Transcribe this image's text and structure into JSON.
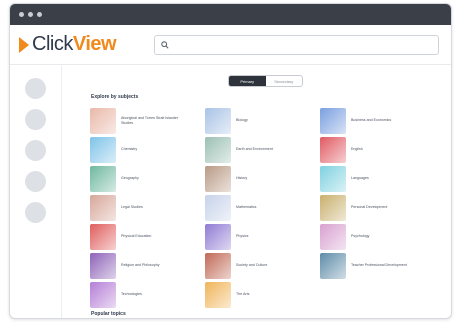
{
  "app": {
    "logo_prefix": "Click",
    "logo_suffix": "View",
    "search_placeholder": ""
  },
  "view_toggle": {
    "options": [
      "Primary",
      "Secondary"
    ],
    "selected": "Primary"
  },
  "sections": {
    "subjects_title": "Explore by subjects",
    "second_title": "Popular topics"
  },
  "subjects": [
    {
      "label": "Aboriginal and Torres Strait Islander Studies",
      "color": "#e9b8a8"
    },
    {
      "label": "Biology",
      "color": "#a9c3e6"
    },
    {
      "label": "Business and Economics",
      "color": "#7a9fe0"
    },
    {
      "label": "Chemistry",
      "color": "#7fc3e8"
    },
    {
      "label": "Earth and Environment",
      "color": "#9cc0b4"
    },
    {
      "label": "English",
      "color": "#e05a62"
    },
    {
      "label": "Geography",
      "color": "#6fb8a0"
    },
    {
      "label": "History",
      "color": "#b99a86"
    },
    {
      "label": "Languages",
      "color": "#7fd1e0"
    },
    {
      "label": "Legal Studies",
      "color": "#d7a79a"
    },
    {
      "label": "Mathematics",
      "color": "#c7d3ea"
    },
    {
      "label": "Personal Development",
      "color": "#c9b06e"
    },
    {
      "label": "Physical Education",
      "color": "#e05e5e"
    },
    {
      "label": "Physics",
      "color": "#8f7bd3"
    },
    {
      "label": "Psychology",
      "color": "#d8a1d0"
    },
    {
      "label": "Religion and Philosophy",
      "color": "#8e63b8"
    },
    {
      "label": "Society and Culture",
      "color": "#c06a56"
    },
    {
      "label": "Teacher Professional Development",
      "color": "#5e8ca8"
    },
    {
      "label": "Technologies",
      "color": "#b57fd6"
    },
    {
      "label": "The Arts",
      "color": "#f0b55a"
    }
  ]
}
